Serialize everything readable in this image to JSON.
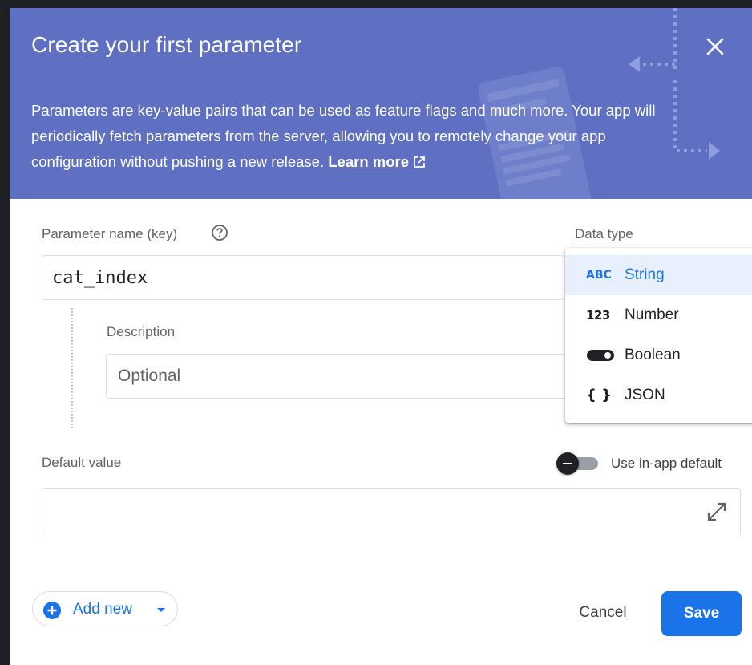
{
  "dialog": {
    "title": "Create your first parameter",
    "description": "Parameters are key-value pairs that can be used as feature flags and much more. Your app will periodically fetch parameters from the server, allowing you to remotely change your app configuration without pushing a new release.",
    "learn_more": "Learn more"
  },
  "form": {
    "param_name_label": "Parameter name (key)",
    "param_name_value": "cat_index",
    "description_label": "Description",
    "description_placeholder": "Optional",
    "data_type_label": "Data type",
    "default_value_label": "Default value",
    "default_value_value": "",
    "use_in_app_default_label": "Use in-app default",
    "use_in_app_default_on": false
  },
  "data_type_options": [
    {
      "icon_text": "ABC",
      "label": "String",
      "selected": true
    },
    {
      "icon_text": "123",
      "label": "Number",
      "selected": false
    },
    {
      "icon_text": "",
      "label": "Boolean",
      "selected": false
    },
    {
      "icon_text": "{ }",
      "label": "JSON",
      "selected": false
    }
  ],
  "footer": {
    "add_new_label": "Add new",
    "cancel_label": "Cancel",
    "save_label": "Save"
  },
  "colors": {
    "header_bg": "#5f6fc2",
    "primary": "#1a73e8"
  }
}
